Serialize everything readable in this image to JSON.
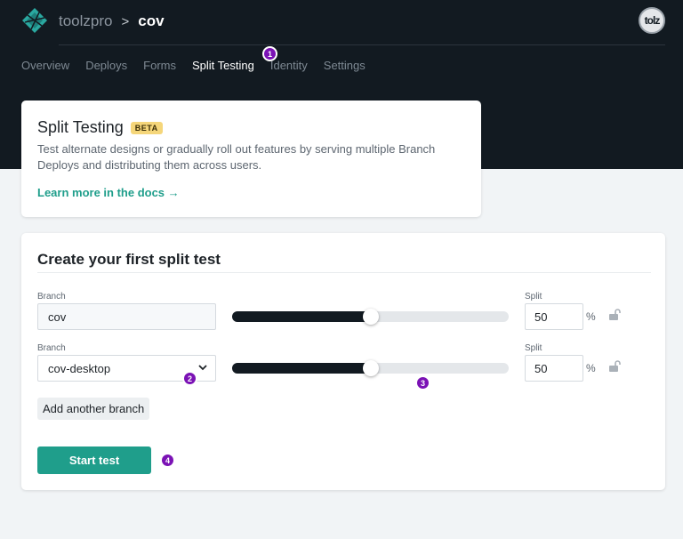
{
  "header": {
    "org_name": "toolzpro",
    "separator": ">",
    "site_name": "cov",
    "avatar_text": "tolz",
    "nav_tabs": [
      "Overview",
      "Deploys",
      "Forms",
      "Split Testing",
      "Identity",
      "Settings"
    ],
    "active_tab": "Split Testing"
  },
  "markers": [
    "1",
    "2",
    "3",
    "4"
  ],
  "intro_card": {
    "title": "Split Testing",
    "badge": "BETA",
    "description": "Test alternate designs or gradually roll out features by serving multiple Branch Deploys and distributing them across users.",
    "link_text": "Learn more in the docs",
    "link_arrow": "→"
  },
  "test_card": {
    "heading": "Create your first split test",
    "rows": [
      {
        "branch_label": "Branch",
        "branch_value": "cov",
        "split_label": "Split",
        "split_value": "50",
        "percent_sign": "%",
        "slider_percent": 50
      },
      {
        "branch_label": "Branch",
        "branch_value": "cov-desktop",
        "split_label": "Split",
        "split_value": "50",
        "percent_sign": "%",
        "slider_percent": 50
      }
    ],
    "add_branch_label": "Add another branch",
    "start_label": "Start test"
  },
  "colors": {
    "header_bg": "#121a21",
    "accent": "#1f9e8b",
    "marker": "#7b12b5",
    "beta_badge": "#f5d67a"
  },
  "icons": {
    "logo": "netlify-logo-icon",
    "lock": "unlocked-padlock-icon",
    "dropdown": "chevron-down-icon",
    "arrow": "arrow-right-icon"
  }
}
